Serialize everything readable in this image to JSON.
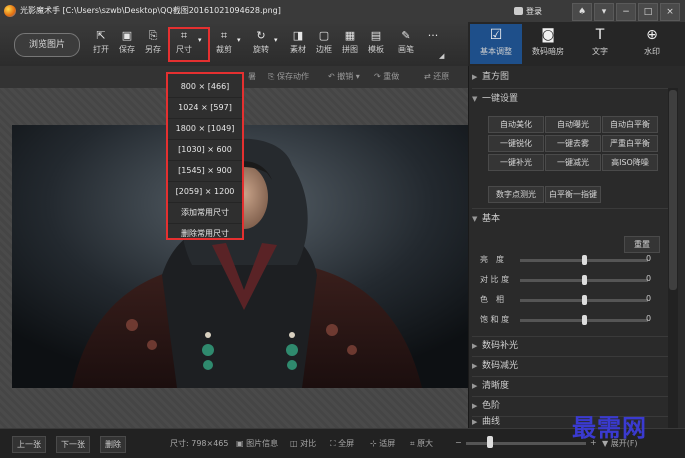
{
  "window": {
    "title": "光影魔术手 [C:\\Users\\szwb\\Desktop\\QQ截图20161021094628.png]",
    "login": "登录",
    "controls": [
      "♠",
      "▾",
      "−",
      "□",
      "×"
    ]
  },
  "toolbar": {
    "browse": "浏览图片",
    "tools": [
      {
        "icon": "⇱",
        "label": "打开"
      },
      {
        "icon": "▣",
        "label": "保存"
      },
      {
        "icon": "⎘",
        "label": "另存"
      },
      {
        "icon": "⌗",
        "label": "尺寸"
      },
      {
        "icon": "⌗",
        "label": "裁剪"
      },
      {
        "icon": "↻",
        "label": "旋转"
      },
      {
        "icon": "◨",
        "label": "素材"
      },
      {
        "icon": "▢",
        "label": "边框"
      },
      {
        "icon": "▦",
        "label": "拼图"
      },
      {
        "icon": "▤",
        "label": "模板"
      },
      {
        "icon": "✎",
        "label": "画笔"
      },
      {
        "icon": "···",
        "label": ""
      }
    ]
  },
  "right_tabs": [
    {
      "icon": "☑",
      "label": "基本调整"
    },
    {
      "icon": "◙",
      "label": "数码暗房"
    },
    {
      "icon": "T",
      "label": "文字"
    },
    {
      "icon": "⊕",
      "label": "水印"
    }
  ],
  "subtoolbar": {
    "save_action": "保存动作",
    "undo": "撤销",
    "redo": "重做",
    "compare": "还原"
  },
  "size_menu": {
    "items": [
      "800 × [466]",
      "1024 × [597]",
      "1800 × [1049]",
      "[1030] × 600",
      "[1545] × 900",
      "[2059] × 1200",
      "添加常用尺寸",
      "删除常用尺寸"
    ]
  },
  "panel": {
    "histogram": "直方图",
    "one_click": {
      "title": "一键设置",
      "buttons": [
        "自动美化",
        "自动曝光",
        "自动白平衡",
        "一键锐化",
        "一键去雾",
        "严重白平衡",
        "一键补光",
        "一键减光",
        "高ISO降噪"
      ],
      "extra": [
        "数字点测光",
        "白平衡一指键"
      ]
    },
    "basic": {
      "title": "基本",
      "reset": "重置",
      "sliders": [
        {
          "label": "亮　度",
          "value": "0",
          "level": 0.5
        },
        {
          "label": "对 比 度",
          "value": "0",
          "level": 0.5
        },
        {
          "label": "色　相",
          "value": "0",
          "level": 0.5
        },
        {
          "label": "饱 和 度",
          "value": "0",
          "level": 0.5
        }
      ]
    },
    "sections": [
      "数码补光",
      "数码减光",
      "清晰度",
      "色阶",
      "曲线"
    ]
  },
  "status": {
    "prev": "上一张",
    "next": "下一张",
    "delete": "删除",
    "size": "尺寸: 798×465",
    "info": "图片信息",
    "compare": "对比",
    "fullscreen": "全屏",
    "fit": "适屏",
    "original": "原大",
    "expand": "展开(F)",
    "zoom_level": 0.2
  },
  "watermark": "最需网"
}
